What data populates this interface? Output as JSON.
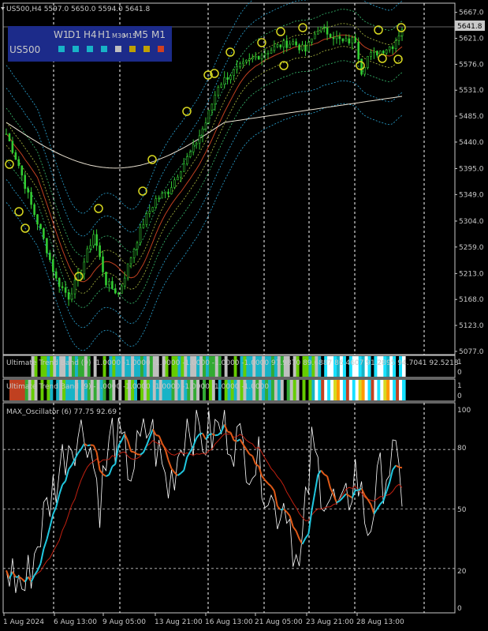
{
  "header": {
    "symbol_line": "US500,H4  5597.0 5650.0 5594.0 5641.8",
    "price_tag": "5641.8"
  },
  "tf_panel": {
    "symbol": "US500",
    "big": [
      "W1",
      "D1",
      "H4",
      "H1"
    ],
    "small": [
      "M30",
      "M15"
    ],
    "big2": [
      "M5",
      "M1"
    ],
    "colors": [
      "#17b3c7",
      "#17b3c7",
      "#17b3c7",
      "#17b3c7",
      "#bfbfbf",
      "#bfa000",
      "#bfa000",
      "#d04020"
    ]
  },
  "price_axis": [
    "5667.0",
    "5621.0",
    "5576.0",
    "5531.0",
    "5485.0",
    "5440.0",
    "5395.0",
    "5349.0",
    "5304.0",
    "5259.0",
    "5213.0",
    "5168.0",
    "5123.0",
    "5077.0"
  ],
  "band1": {
    "label": "Ultimate Trend Band (9) -1.0000 -1.0000 -1.0000 -1.0000 -1.0000 -1.0000 97.9870 89.6887 86.4607 91.2895 94.7041 92.5218",
    "ticks": [
      "1",
      "0"
    ]
  },
  "band2": {
    "label": "Ultimate Trend Band (9) -1.0000 -1.0000 -1.0000 -1.0000 -1.0000 -1.0000",
    "ticks": [
      "1",
      "0"
    ]
  },
  "oscillator": {
    "label": "MAX_Oscillator (6) 77.75 92.69",
    "axis": [
      "100",
      "80",
      "50",
      "20",
      "0"
    ]
  },
  "time_axis": [
    "1 Aug 2024",
    "6 Aug 13:00",
    "9 Aug 05:00",
    "13 Aug 21:00",
    "16 Aug 13:00",
    "21 Aug 05:00",
    "23 Aug 21:00",
    "28 Aug 13:00"
  ]
}
